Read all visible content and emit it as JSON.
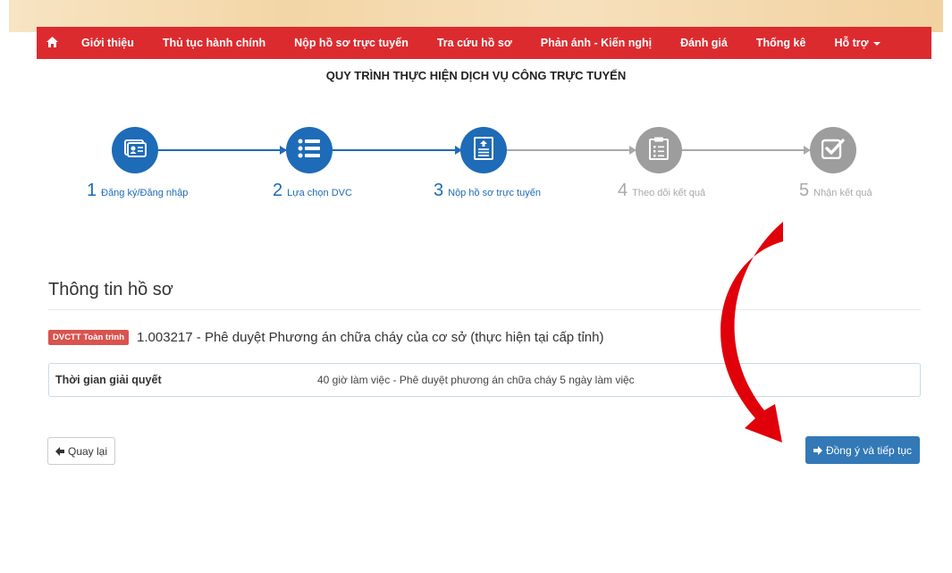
{
  "nav": {
    "home_icon": "home-icon",
    "items": [
      {
        "label": "Giới thiệu"
      },
      {
        "label": "Thủ tục hành chính"
      },
      {
        "label": "Nộp hồ sơ trực tuyến"
      },
      {
        "label": "Tra cứu hồ sơ"
      },
      {
        "label": "Phản ánh - Kiến nghị"
      },
      {
        "label": "Đánh giá"
      },
      {
        "label": "Thống kê"
      },
      {
        "label": "Hỗ trợ"
      }
    ]
  },
  "process": {
    "title": "QUY TRÌNH THỰC HIỆN DỊCH VỤ CÔNG TRỰC TUYẾN",
    "steps": [
      {
        "num": "1",
        "label": "Đăng ký/Đăng nhập",
        "icon": "id-card-icon",
        "state": "active"
      },
      {
        "num": "2",
        "label": "Lựa chọn DVC",
        "icon": "list-icon",
        "state": "active"
      },
      {
        "num": "3",
        "label": "Nộp hồ sơ trực tuyến",
        "icon": "upload-document-icon",
        "state": "active"
      },
      {
        "num": "4",
        "label": "Theo dõi kết quả",
        "icon": "clipboard-icon",
        "state": "inactive"
      },
      {
        "num": "5",
        "label": "Nhận kết quả",
        "icon": "check-square-icon",
        "state": "inactive"
      }
    ]
  },
  "record": {
    "section_title": "Thông tin hồ sơ",
    "badge": "DVCTT Toàn trình",
    "service_name": "1.003217 - Phê duyệt Phương án chữa cháy của cơ sở (thực hiện tại cấp tỉnh)",
    "time_label": "Thời gian giải quyết",
    "time_value": "40 giờ làm việc - Phê duyệt phương án chữa cháy 5 ngày làm việc"
  },
  "actions": {
    "back_label": "Quay lại",
    "next_label": "Đồng ý và tiếp tục"
  },
  "colors": {
    "nav_bg": "#dc2b2f",
    "step_active": "#1e6bb8",
    "step_inactive": "#9d9d9d",
    "primary_button": "#3379b7",
    "badge": "#d9534f",
    "annotation_arrow": "#e0000a"
  }
}
